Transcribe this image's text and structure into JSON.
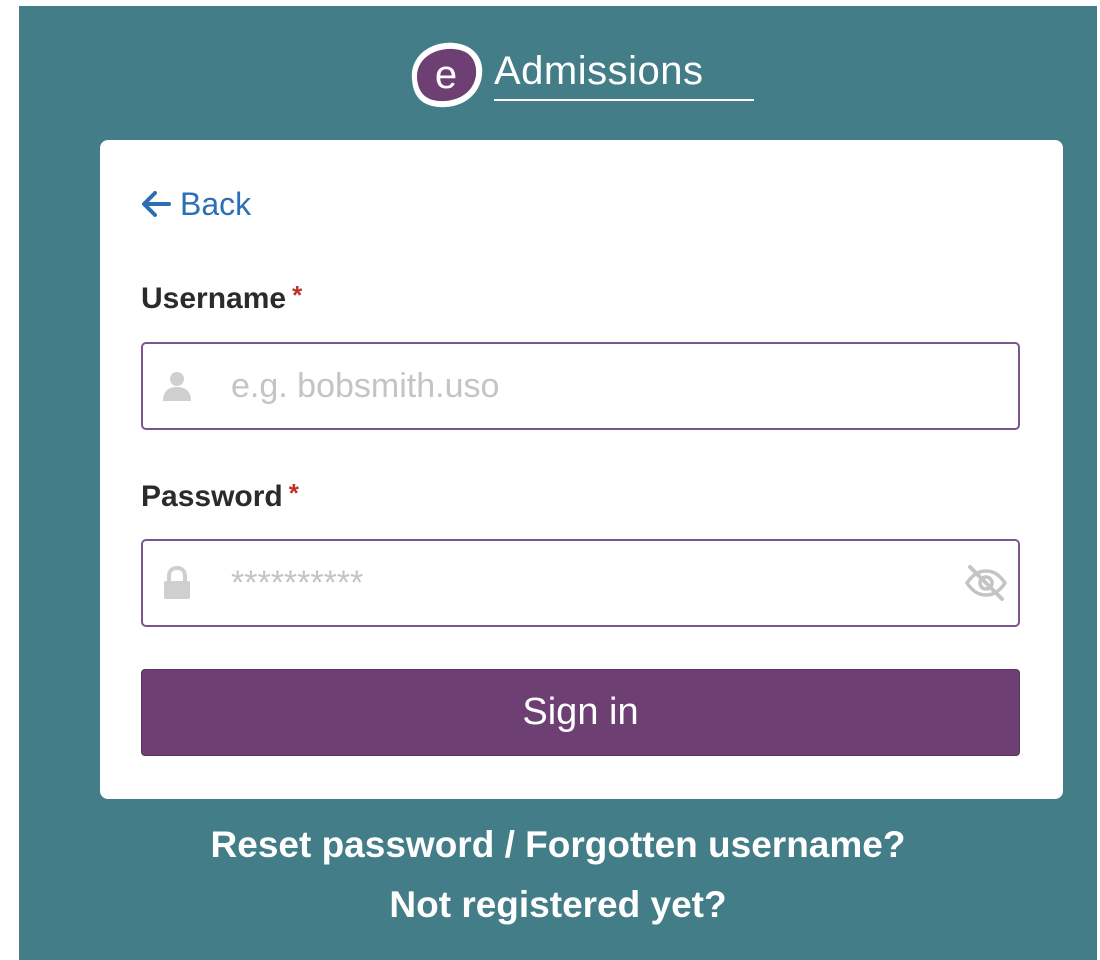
{
  "brand": {
    "mark_letter": "e",
    "name": "Admissions",
    "mark_color": "#6d3f72",
    "background_color": "#437d87"
  },
  "form": {
    "back_label": "Back",
    "username": {
      "label": "Username",
      "required_marker": "*",
      "placeholder": "e.g. bobsmith.uso",
      "value": "",
      "icon": "user-icon"
    },
    "password": {
      "label": "Password",
      "required_marker": "*",
      "placeholder": "**********",
      "value": "",
      "icon": "lock-icon",
      "toggle_icon": "eye-slash-icon"
    },
    "submit_label": "Sign in",
    "submit_color": "#6d3f72"
  },
  "footer": {
    "reset_label": "Reset password / Forgotten username?",
    "register_label": "Not registered yet?"
  }
}
